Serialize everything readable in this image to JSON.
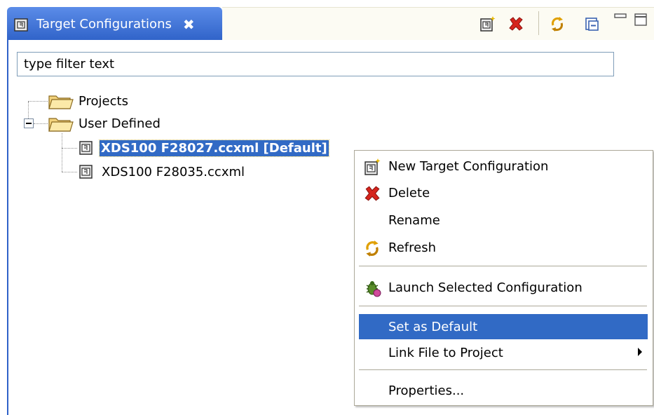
{
  "tab": {
    "label": "Target Configurations",
    "close_glyph": "✖",
    "icon": "target-config-icon"
  },
  "toolbar": {
    "buttons": [
      {
        "name": "new-target-config-icon"
      },
      {
        "name": "delete-icon"
      },
      {
        "name": "refresh-icon"
      },
      {
        "name": "collapse-all-icon"
      },
      {
        "name": "minimize-icon"
      },
      {
        "name": "maximize-icon"
      }
    ]
  },
  "filter": {
    "value": "type filter text"
  },
  "tree": {
    "items": [
      {
        "label": "Projects",
        "icon": "folder-icon"
      },
      {
        "label": "User Defined",
        "icon": "folder-open-icon"
      },
      {
        "label": "XDS100 F28027.ccxml [Default]",
        "icon": "target-config-icon",
        "selected": true
      },
      {
        "label": "XDS100 F28035.ccxml",
        "icon": "target-config-icon",
        "selected": false
      }
    ]
  },
  "context_menu": {
    "items": [
      {
        "label": "New Target Configuration",
        "icon": "new-target-config-icon"
      },
      {
        "label": "Delete",
        "icon": "delete-icon"
      },
      {
        "label": "Rename",
        "icon": ""
      },
      {
        "label": "Refresh",
        "icon": "refresh-icon"
      },
      {
        "label": "Launch Selected Configuration",
        "icon": "debug-launch-icon"
      },
      {
        "label": "Set as Default",
        "icon": "",
        "highlighted": true
      },
      {
        "label": "Link File to Project",
        "icon": "",
        "submenu": true
      },
      {
        "label": "Properties...",
        "icon": ""
      }
    ]
  },
  "colors": {
    "tab_active": "#2f62c8",
    "selection": "#316ac5",
    "toolbar_bg": "#fcfbf3",
    "delete_red": "#d6241c"
  }
}
